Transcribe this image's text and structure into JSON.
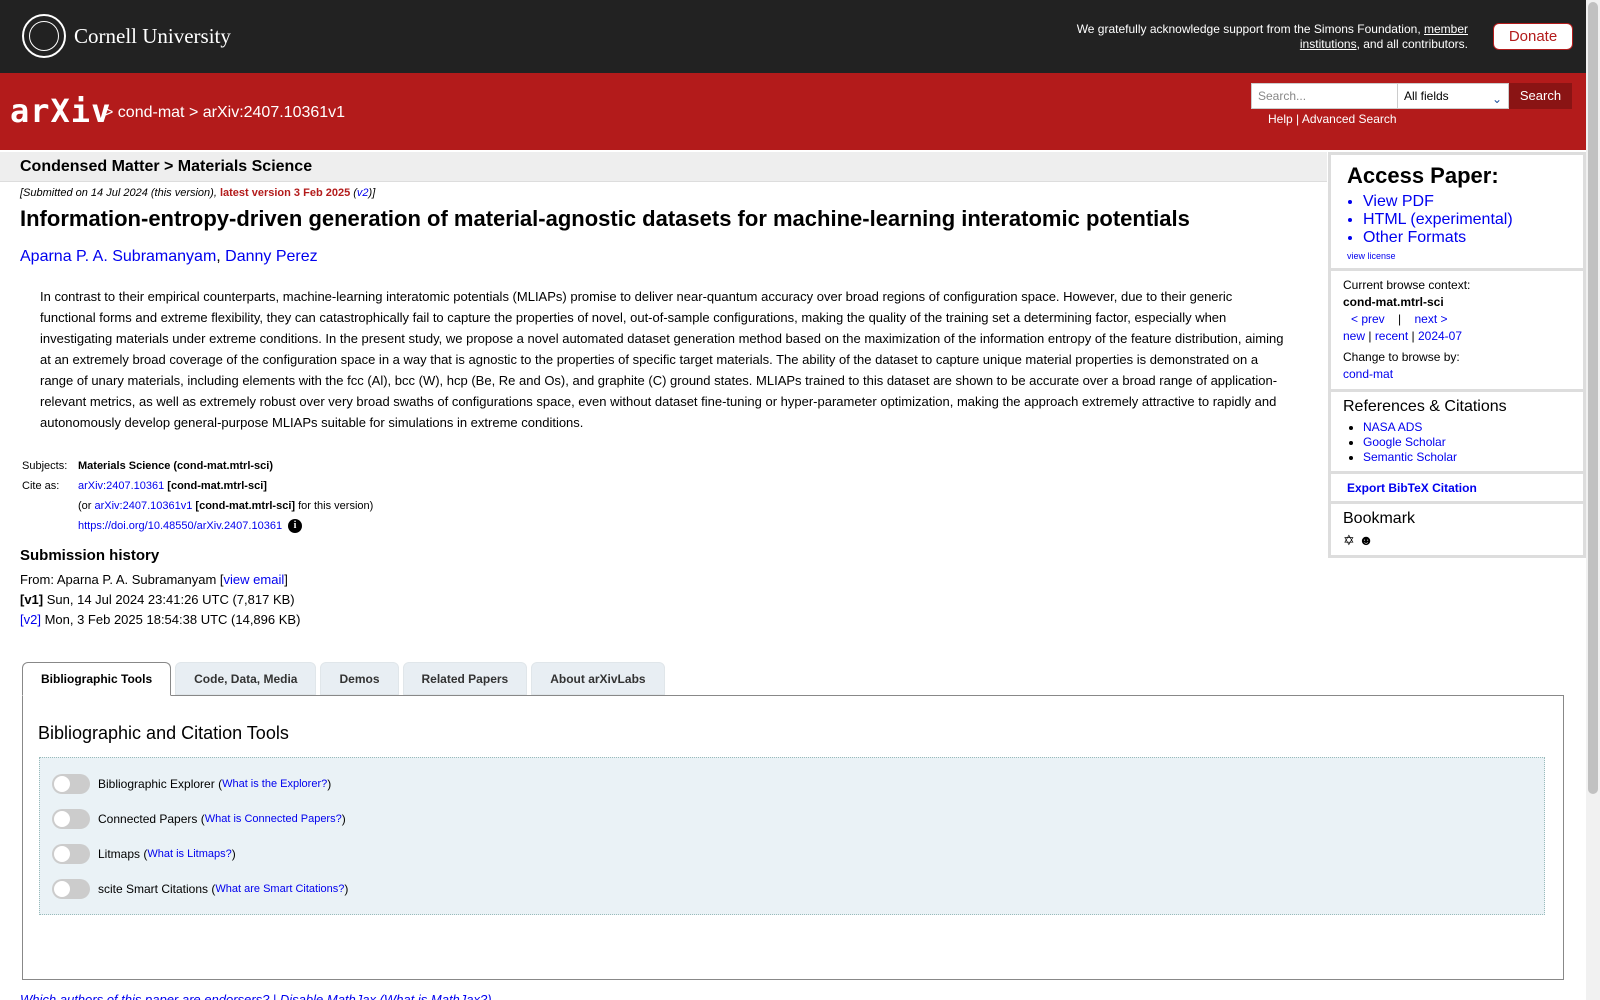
{
  "top": {
    "university": "Cornell University",
    "support_text": "We gratefully acknowledge support from the Simons Foundation, ",
    "support_link": "member institutions",
    "support_tail": ", and all contributors.",
    "donate": "Donate"
  },
  "header": {
    "logo": "arXiv",
    "crumb1": "cond-mat",
    "crumb2": "arXiv:2407.10361v1",
    "search_placeholder": "Search...",
    "search_field": "All fields",
    "search_button": "Search",
    "help": "Help",
    "advanced": "Advanced Search"
  },
  "paper": {
    "subject_bar": "Condensed Matter > Materials Science",
    "submitted": "[Submitted on 14 Jul 2024 (this version), ",
    "latest": "latest version 3 Feb 2025",
    "v2": "v2",
    "title": "Information-entropy-driven generation of material-agnostic datasets for machine-learning interatomic potentials",
    "author1": "Aparna P. A. Subramanyam",
    "author2": "Danny Perez",
    "abstract": "In contrast to their empirical counterparts, machine-learning interatomic potentials (MLIAPs) promise to deliver near-quantum accuracy over broad regions of configuration space. However, due to their generic functional forms and extreme flexibility, they can catastrophically fail to capture the properties of novel, out-of-sample configurations, making the quality of the training set a determining factor, especially when investigating materials under extreme conditions. In the present study, we propose a novel automated dataset generation method based on the maximization of the information entropy of the feature distribution, aiming at an extremely broad coverage of the configuration space in a way that is agnostic to the properties of specific target materials. The ability of the dataset to capture unique material properties is demonstrated on a range of unary materials, including elements with the fcc (Al), bcc (W), hcp (Be, Re and Os), and graphite (C) ground states. MLIAPs trained to this dataset are shown to be accurate over a broad range of application-relevant metrics, as well as extremely robust over very broad swaths of configurations space, even without dataset fine-tuning or hyper-parameter optimization, making the approach extremely attractive to rapidly and autonomously develop general-purpose MLIAPs suitable for simulations in extreme conditions."
  },
  "meta": {
    "subjects_label": "Subjects:",
    "subjects": "Materials Science (cond-mat.mtrl-sci)",
    "cite_label": "Cite as:",
    "cite_id": "arXiv:2407.10361",
    "cite_cat": "[cond-mat.mtrl-sci]",
    "or_text": "(or ",
    "cite_v1": "arXiv:2407.10361v1",
    "for_version": " for this version)",
    "doi": "https://doi.org/10.48550/arXiv.2407.10361"
  },
  "history": {
    "title": "Submission history",
    "from": "From: Aparna P. A. Subramanyam [",
    "view_email": "view email",
    "v1_label": "[v1]",
    "v1_text": " Sun, 14 Jul 2024 23:41:26 UTC (7,817 KB)",
    "v2_label": "[v2]",
    "v2_text": " Mon, 3 Feb 2025 18:54:38 UTC (14,896 KB)"
  },
  "tabs": {
    "t1": "Bibliographic Tools",
    "t2": "Code, Data, Media",
    "t3": "Demos",
    "t4": "Related Papers",
    "t5": "About arXivLabs",
    "panel_title": "Bibliographic and Citation Tools",
    "tool1": "Bibliographic Explorer",
    "tool1_link": "What is the Explorer?",
    "tool2": "Connected Papers",
    "tool2_link": "What is Connected Papers?",
    "tool3": "Litmaps",
    "tool3_link": "What is Litmaps?",
    "tool4": "scite Smart Citations",
    "tool4_link": "What are Smart Citations?"
  },
  "footer": {
    "text": "Which authors of this paper are endorsers? | Disable MathJax (What is MathJax?)"
  },
  "sidebar": {
    "access_title": "Access Paper:",
    "view_pdf": "View PDF",
    "html": "HTML (experimental)",
    "other_formats": "Other Formats",
    "view_license": "view license",
    "context_label": "Current browse context:",
    "context": "cond-mat.mtrl-sci",
    "prev": "< prev",
    "sep": "|",
    "next": "next >",
    "new": "new",
    "recent": "recent",
    "month": "2024-07",
    "change_label": "Change to browse by:",
    "change_cat": "cond-mat",
    "refs_title": "References & Citations",
    "nasa": "NASA ADS",
    "google": "Google Scholar",
    "semantic": "Semantic Scholar",
    "bibtex": "Export BibTeX Citation",
    "bookmark": "Bookmark"
  }
}
